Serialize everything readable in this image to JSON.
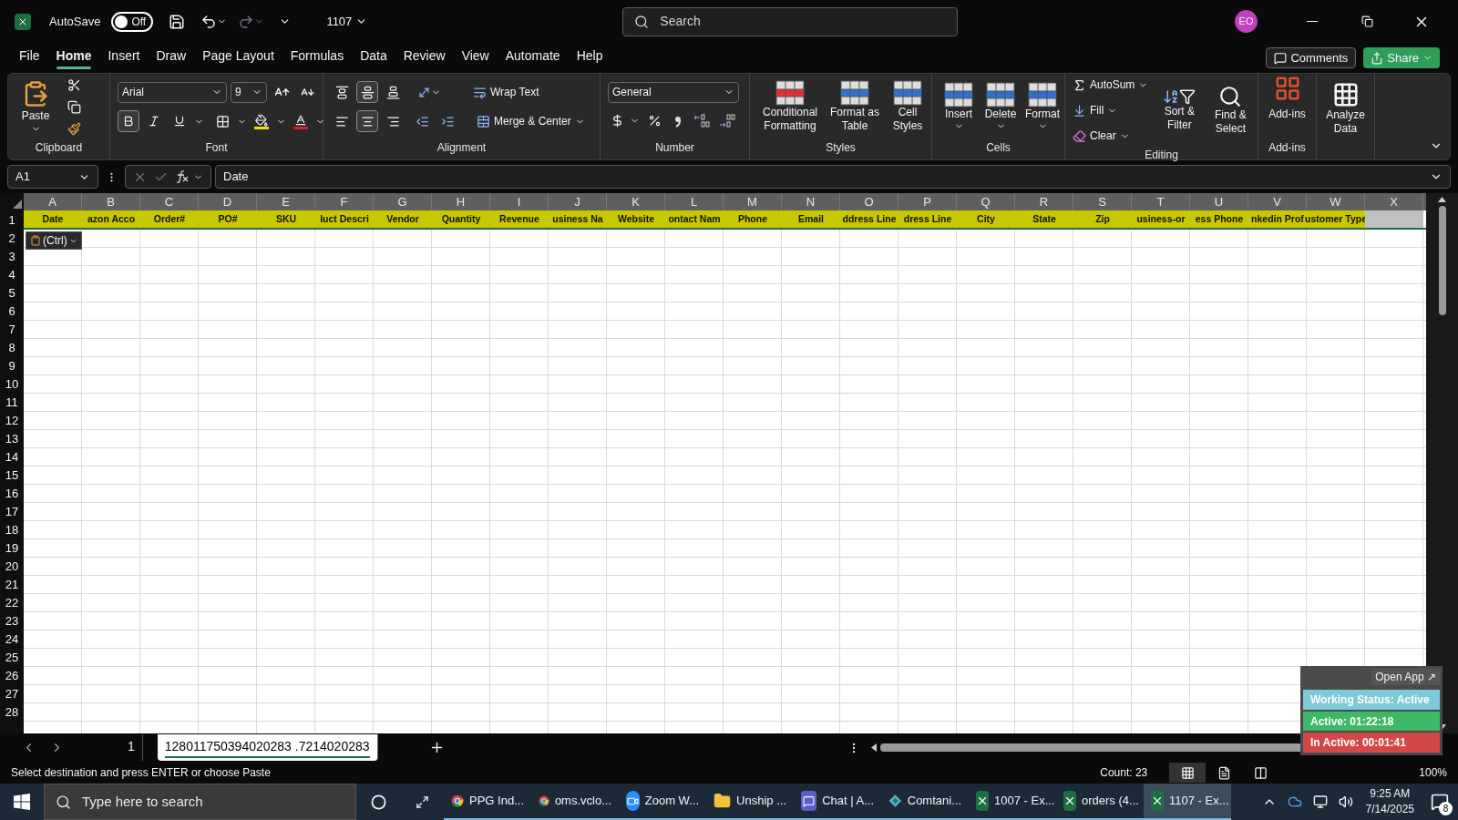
{
  "title_bar": {
    "autosave_label": "AutoSave",
    "autosave_on": false,
    "autosave_state": "Off",
    "file_name": "1107",
    "search_placeholder": "Search",
    "avatar": "EO"
  },
  "menu_tabs": [
    {
      "label": "File",
      "selected": false
    },
    {
      "label": "Home",
      "selected": true
    },
    {
      "label": "Insert",
      "selected": false
    },
    {
      "label": "Draw",
      "selected": false
    },
    {
      "label": "Page Layout",
      "selected": false
    },
    {
      "label": "Formulas",
      "selected": false
    },
    {
      "label": "Data",
      "selected": false
    },
    {
      "label": "Review",
      "selected": false
    },
    {
      "label": "View",
      "selected": false
    },
    {
      "label": "Automate",
      "selected": false
    },
    {
      "label": "Help",
      "selected": false
    }
  ],
  "comments_button": "Comments",
  "share_button": "Share",
  "ribbon": {
    "clipboard": {
      "paste": "Paste",
      "label": "Clipboard"
    },
    "font": {
      "font_name": "Arial",
      "font_size": "9",
      "bold_on": true,
      "label": "Font"
    },
    "alignment": {
      "middle_on": true,
      "center_on": true,
      "wrap_text": "Wrap Text",
      "merge_center": "Merge & Center",
      "label": "Alignment"
    },
    "number": {
      "format": "General",
      "label": "Number"
    },
    "styles": {
      "items": [
        "Conditional Formatting",
        "Format as Table",
        "Cell Styles"
      ],
      "label": "Styles"
    },
    "cells": {
      "items": [
        "Insert",
        "Delete",
        "Format"
      ],
      "label": "Cells"
    },
    "editing": {
      "autosum": "AutoSum",
      "fill": "Fill",
      "clear": "Clear",
      "sort_filter": "Sort & Filter",
      "find_select": "Find & Select",
      "label": "Editing"
    },
    "addins": {
      "button": "Add-ins",
      "label": "Add-ins"
    },
    "analyze": {
      "button": "Analyze Data"
    }
  },
  "formula_bar": {
    "name_box": "A1",
    "formula": "Date"
  },
  "grid": {
    "columns": [
      "A",
      "B",
      "C",
      "D",
      "E",
      "F",
      "G",
      "H",
      "I",
      "J",
      "K",
      "L",
      "M",
      "N",
      "O",
      "P",
      "Q",
      "R",
      "S",
      "T",
      "U",
      "V",
      "W",
      "X"
    ],
    "header_cells": [
      "Date",
      "azon Acco",
      "Order#",
      "PO#",
      "SKU",
      "luct Descri",
      "Vendor",
      "Quantity",
      "Revenue",
      "usiness Na",
      "Website",
      "ontact Nam",
      "Phone",
      "Email",
      "ddress Line",
      "dress Line",
      "City",
      "State",
      "Zip",
      "usiness-or",
      "ess Phone",
      "nkedin Prof",
      "ustomer Type"
    ],
    "row_numbers": [
      "1",
      "2",
      "3",
      "4",
      "5",
      "6",
      "7",
      "8",
      "9",
      "10",
      "11",
      "12",
      "13",
      "14",
      "15",
      "16",
      "17",
      "18",
      "19",
      "20",
      "21",
      "22",
      "23",
      "24",
      "25",
      "26",
      "27",
      "28"
    ],
    "paste_options": "(Ctrl)"
  },
  "sheet_tabs": [
    {
      "label": "1",
      "selected": false
    },
    {
      "label": "128011750394020283 .7214020283",
      "selected": true
    }
  ],
  "status_bar": {
    "message": "Select destination and press ENTER or choose Paste",
    "count": "Count: 23",
    "zoom": "100%"
  },
  "tracker": {
    "open_app": "Open App ↗",
    "working_status": "Working Status: Active",
    "active": "Active: 01:22:18",
    "inactive": "In Active: 00:01:41"
  },
  "taskbar": {
    "search_placeholder": "Type here to search",
    "apps": [
      {
        "kind": "chrome",
        "label": "PPG Ind...",
        "active": false
      },
      {
        "kind": "chrome",
        "label": "oms.vclo...",
        "active": false
      },
      {
        "kind": "zoom",
        "label": "Zoom W...",
        "active": false
      },
      {
        "kind": "folder",
        "label": "Unship ...",
        "active": false
      },
      {
        "kind": "teams",
        "label": "Chat | A...",
        "active": false
      },
      {
        "kind": "diamond",
        "label": "Comtani...",
        "active": false
      },
      {
        "kind": "excel",
        "label": "1007 - Ex...",
        "active": false
      },
      {
        "kind": "excel",
        "label": "orders (4...",
        "active": false
      },
      {
        "kind": "excel",
        "label": "1107 - Ex...",
        "active": true
      }
    ],
    "time": "9:25 AM",
    "date": "7/14/2025",
    "notifications": "8"
  }
}
